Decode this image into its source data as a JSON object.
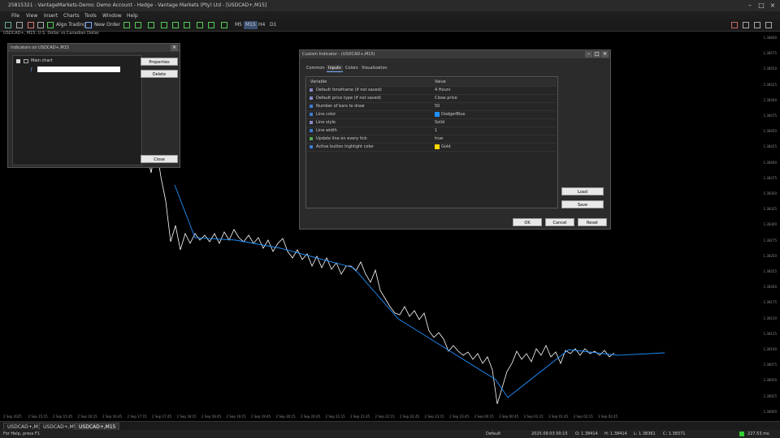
{
  "window": {
    "title": "25815321 - VantageMarkets-Demo: Demo Account - Hedge - Vantage Markets (Pty) Ltd - [USDCAD+,M15]"
  },
  "menu": [
    "File",
    "View",
    "Insert",
    "Charts",
    "Tools",
    "Window",
    "Help"
  ],
  "toolbar": {
    "algo": "Algo Trading",
    "new_order": "New Order",
    "timeframes": [
      "M5",
      "M15",
      "H4",
      "D1"
    ],
    "active_tf": "M15"
  },
  "chart": {
    "header": "USDCAD+, M15: U.S. Dollar vs Canadian Dollar",
    "prices": [
      "1.38600",
      "1.38575",
      "1.38550",
      "1.38525",
      "1.38500",
      "1.38475",
      "1.38450",
      "1.38425",
      "1.38400",
      "1.38375",
      "1.38350",
      "1.38325",
      "1.38300",
      "1.38275",
      "1.38250",
      "1.38225",
      "1.38200",
      "1.38175",
      "1.38150",
      "1.38125",
      "1.38100",
      "1.38075",
      "1.38050",
      "1.38025",
      "1.38000"
    ],
    "times": [
      "2 Sep 2025",
      "2 Sep 15:15",
      "2 Sep 15:45",
      "2 Sep 16:15",
      "2 Sep 16:45",
      "2 Sep 17:15",
      "2 Sep 17:45",
      "2 Sep 18:15",
      "2 Sep 18:45",
      "2 Sep 19:15",
      "2 Sep 19:45",
      "2 Sep 20:15",
      "2 Sep 20:45",
      "2 Sep 21:15",
      "2 Sep 21:45",
      "2 Sep 22:15",
      "2 Sep 22:45",
      "2 Sep 23:15",
      "2 Sep 23:45",
      "3 Sep 00:15",
      "3 Sep 00:45",
      "3 Sep 01:15",
      "3 Sep 01:45",
      "3 Sep 02:15",
      "3 Sep 02:45"
    ],
    "series_color": "#ffffff",
    "trend_color": "#1e90ff"
  },
  "indicators_dialog": {
    "title": "Indicators on USDCAD+,M15",
    "tree_root": "Main chart",
    "buttons": [
      "Properties",
      "Delete",
      "Close"
    ]
  },
  "props_dialog": {
    "title": "Custom Indicator - (USDCAD+,M15)",
    "tabs": [
      "Common",
      "Inputs",
      "Colors",
      "Visualization"
    ],
    "active_tab": "Inputs",
    "col_variable": "Variable",
    "col_value": "Value",
    "rows": [
      {
        "k": "Default timeframe (if not saved)",
        "v": "4 Hours",
        "icon": "#8888cc"
      },
      {
        "k": "Default price type (if not saved)",
        "v": "Close price",
        "icon": "#8888cc"
      },
      {
        "k": "Number of bars to draw",
        "v": "50",
        "icon": "#3a7bd5"
      },
      {
        "k": "Line color",
        "v": "DodgerBlue",
        "icon": "#3a7bd5",
        "swatch": "#1e90ff"
      },
      {
        "k": "Line style",
        "v": "Solid",
        "icon": "#8888cc"
      },
      {
        "k": "Line width",
        "v": "1",
        "icon": "#3a7bd5"
      },
      {
        "k": "Update line on every tick",
        "v": "true",
        "icon": "#55aa55"
      },
      {
        "k": "Active button highlight color",
        "v": "Gold",
        "icon": "#3a7bd5",
        "swatch": "#ffd700"
      }
    ],
    "side_buttons": [
      "Load",
      "Save"
    ],
    "bottom_buttons": [
      "OK",
      "Cancel",
      "Reset"
    ]
  },
  "chart_tabs": [
    "USDCAD+,M15",
    "USDCAD+,M5",
    "USDCAD+,M15"
  ],
  "status": {
    "help": "For Help, press F1",
    "profile": "Default",
    "time": "2025.09.03 00:15",
    "open": "O: 1.38414",
    "high": "H: 1.38414",
    "low": "L: 1.38361",
    "close": "C: 1.38371",
    "ping": "227.53 ms"
  }
}
